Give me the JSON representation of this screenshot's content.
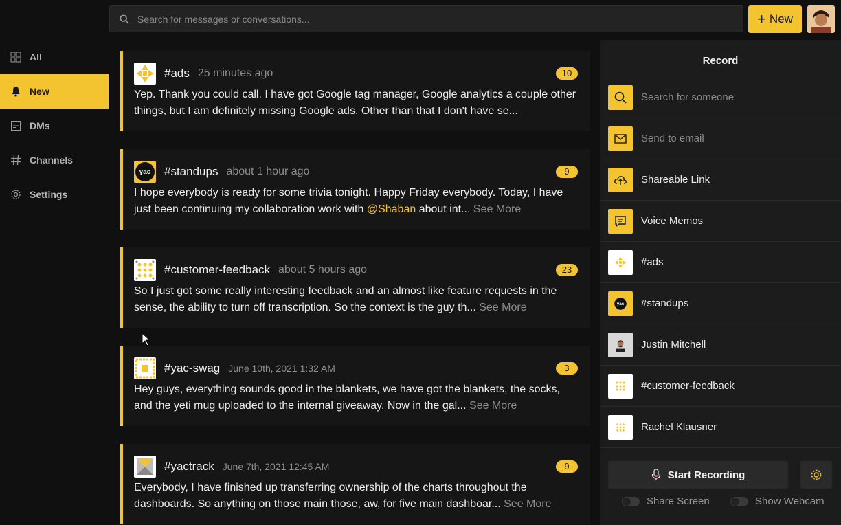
{
  "search": {
    "placeholder": "Search for messages or conversations..."
  },
  "header": {
    "new_label": "New"
  },
  "nav": [
    {
      "label": "All",
      "icon": "grid-icon"
    },
    {
      "label": "New",
      "icon": "bell-icon",
      "active": true
    },
    {
      "label": "DMs",
      "icon": "message-icon"
    },
    {
      "label": "Channels",
      "icon": "hash-icon"
    },
    {
      "label": "Settings",
      "icon": "gear-icon"
    }
  ],
  "feed": [
    {
      "name": "#ads",
      "time": "25 minutes ago",
      "count": "10",
      "text": "Yep. Thank you could call. I have got Google tag manager, Google analytics a couple other things, but I am definitely missing Google ads. Other than that I don't have se..."
    },
    {
      "name": "#standups",
      "time": "about 1 hour ago",
      "count": "9",
      "text_pre": "I hope everybody is ready for some trivia tonight. Happy Friday everybody. Today, I have just been continuing my collaboration work with ",
      "mention": "@Shaban",
      "text_post": " about int...",
      "more": "See More"
    },
    {
      "name": "#customer-feedback",
      "time": "about 5 hours ago",
      "count": "23",
      "text": "So I just got some really interesting feedback and an almost like feature requests in the sense, the ability to turn off transcription. So the context is the guy th...",
      "more": "See More"
    },
    {
      "name": "#yac-swag",
      "time": "June 10th, 2021 1:32 AM",
      "count": "3",
      "text": "Hey guys, everything sounds good in the blankets, we have got the blankets, the socks, and the yeti mug uploaded to the internal giveaway. Now in the gal...",
      "more": "See More"
    },
    {
      "name": "#yactrack",
      "time": "June 7th, 2021 12:45 AM",
      "count": "9",
      "text": "Everybody, I have finished up transferring ownership of the charts throughout the dashboards. So anything on those main those, aw, for five main dashboar...",
      "more": "See More"
    }
  ],
  "panel": {
    "title": "Record",
    "rows": [
      {
        "label": "Search for someone",
        "icon": "search-icon",
        "muted": true
      },
      {
        "label": "Send to email",
        "icon": "mail-icon",
        "muted": true
      },
      {
        "label": "Shareable Link",
        "icon": "cloud-upload-icon"
      },
      {
        "label": "Voice Memos",
        "icon": "memo-icon"
      },
      {
        "label": "#ads",
        "icon": "ads-avatar"
      },
      {
        "label": "#standups",
        "icon": "yac-avatar"
      },
      {
        "label": "Justin Mitchell",
        "icon": "person-avatar"
      },
      {
        "label": "#customer-feedback",
        "icon": "dots-avatar"
      },
      {
        "label": "Rachel Klausner",
        "icon": "dots-avatar"
      }
    ],
    "start_recording": "Start Recording",
    "share_screen": "Share Screen",
    "show_webcam": "Show Webcam"
  },
  "colors": {
    "accent": "#f4c430",
    "background": "#101010",
    "card": "#161616",
    "panel": "#1c1c1c"
  }
}
